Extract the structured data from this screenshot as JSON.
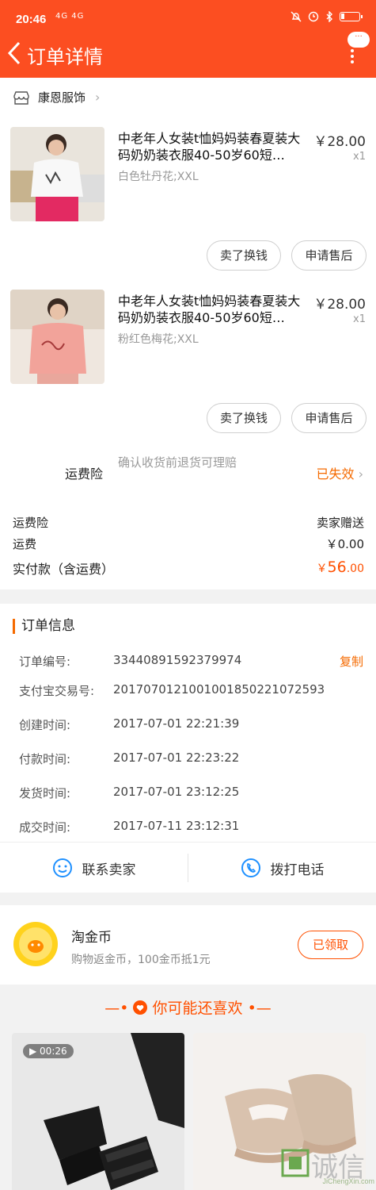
{
  "status_bar": {
    "time": "20:46",
    "signal": "4G 4G"
  },
  "header": {
    "title": "订单详情",
    "chat_badge": "···"
  },
  "shop": {
    "name": "康恩服饰"
  },
  "products": [
    {
      "title": "中老年人女装t恤妈妈装春夏装大码奶奶装衣服40-50岁60短…",
      "sku": "白色牡丹花;XXL",
      "price": "￥28.00",
      "qty": "x1",
      "btn_sell": "卖了换钱",
      "btn_service": "申请售后"
    },
    {
      "title": "中老年人女装t恤妈妈装春夏装大码奶奶装衣服40-50岁60短…",
      "sku": "粉红色梅花;XXL",
      "price": "￥28.00",
      "qty": "x1",
      "btn_sell": "卖了换钱",
      "btn_service": "申请售后"
    }
  ],
  "insurance": {
    "label": "运费险",
    "desc": "确认收货前退货可理赔",
    "status": "已失效"
  },
  "fees": {
    "ins_label": "运费险",
    "ins_value": "卖家赠送",
    "ship_label": "运费",
    "ship_value": "￥0.00",
    "total_label": "实付款（含运费）",
    "total_symbol": "￥",
    "total_int": "56",
    "total_dec": ".00"
  },
  "order_info": {
    "title": "订单信息",
    "copy_label": "复制",
    "rows": [
      {
        "key": "订单编号:",
        "value": "33440891592379974"
      },
      {
        "key": "支付宝交易号:",
        "value": "2017070121001001850221072593"
      },
      {
        "key": "创建时间:",
        "value": "2017-07-01 22:21:39"
      },
      {
        "key": "付款时间:",
        "value": "2017-07-01 22:23:22"
      },
      {
        "key": "发货时间:",
        "value": "2017-07-01 23:12:25"
      },
      {
        "key": "成交时间:",
        "value": "2017-07-11 23:12:31"
      }
    ],
    "contact_seller": "联系卖家",
    "call_phone": "拨打电话"
  },
  "coins": {
    "title": "淘金币",
    "desc": "购物返金币，100金币抵1元",
    "button": "已领取"
  },
  "recommend": {
    "title": "你可能还喜欢",
    "video_duration": "00:26"
  },
  "watermark": {
    "text": "诚信",
    "url": "JiChengXin.com"
  },
  "colors": {
    "brand": "#fc4e21",
    "accent": "#ff5000",
    "orange_text": "#f56a00"
  }
}
